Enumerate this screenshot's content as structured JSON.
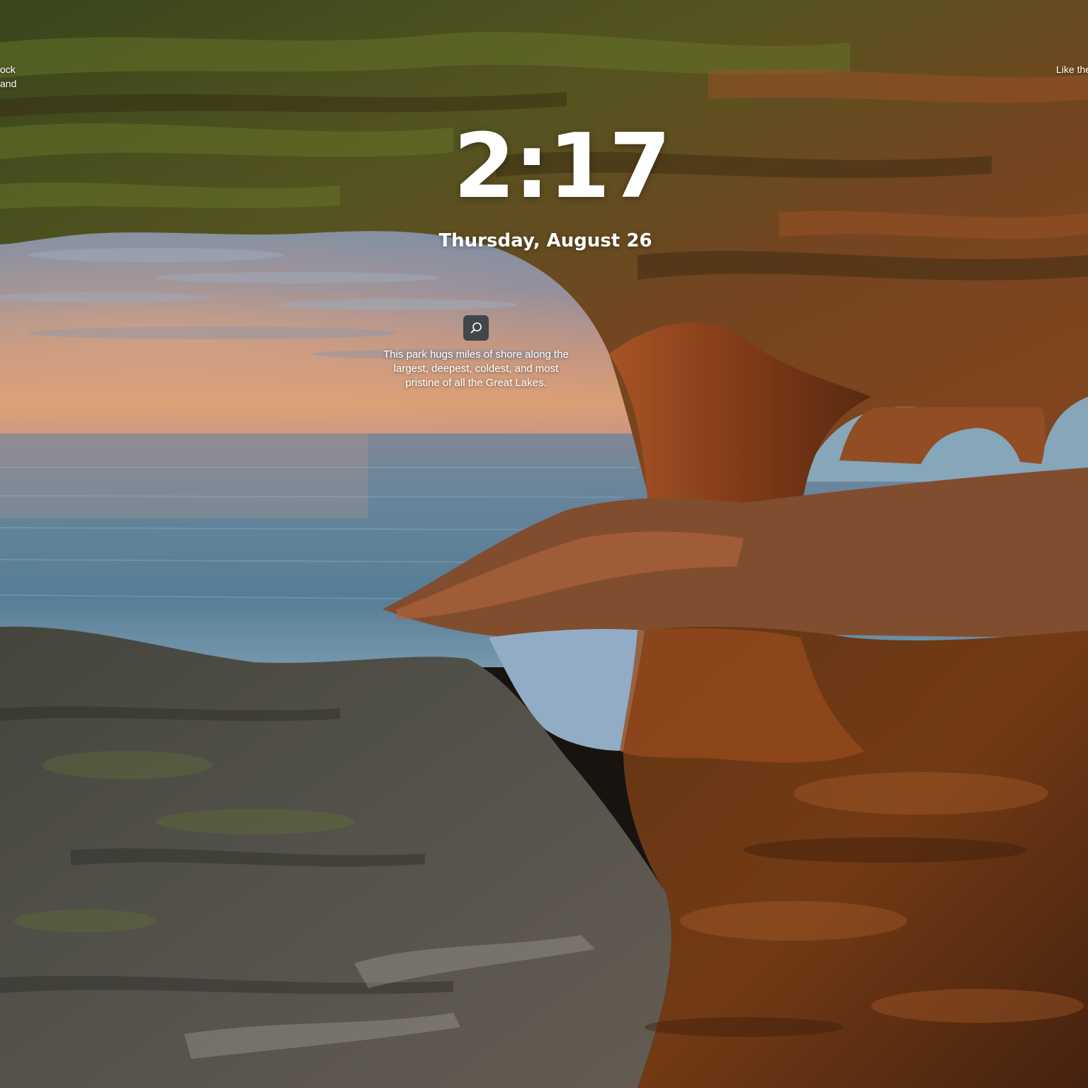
{
  "lock_screen": {
    "time": "2:17",
    "date": "Thursday, August 26"
  },
  "spotlight": {
    "icon": "search-icon",
    "caption": "This park hugs miles of shore along the largest, deepest, coldest, and most pristine of all the Great Lakes."
  },
  "side_notes": {
    "left_line_1": "ock",
    "left_line_2": "and",
    "right": "Like the"
  },
  "colors": {
    "text": "#ffffff",
    "button_bg": "#28343c"
  }
}
